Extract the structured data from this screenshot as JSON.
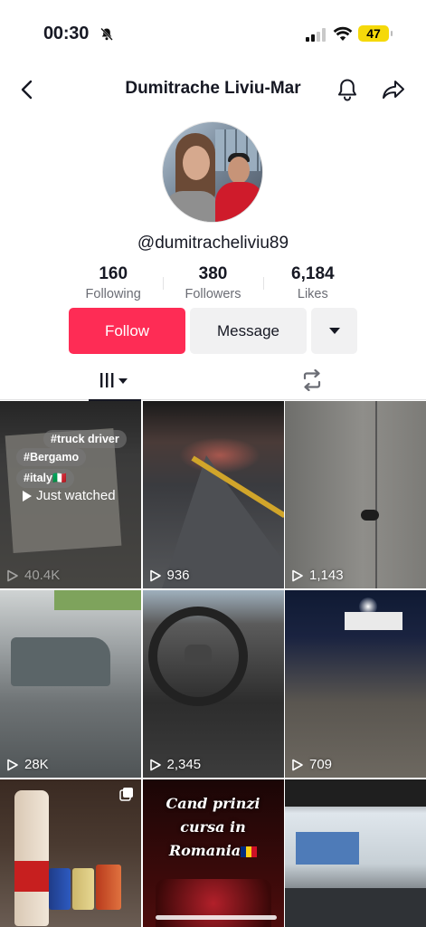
{
  "status_bar": {
    "time": "00:30",
    "battery": "47"
  },
  "header": {
    "title": "Dumitrache Liviu-Mar"
  },
  "profile": {
    "username": "@dumitracheliviu89",
    "stats": [
      {
        "value": "160",
        "label": "Following"
      },
      {
        "value": "380",
        "label": "Followers"
      },
      {
        "value": "6,184",
        "label": "Likes"
      }
    ]
  },
  "actions": {
    "follow_label": "Follow",
    "message_label": "Message"
  },
  "colors": {
    "follow": "#fe2c55",
    "battery": "#f5d90a"
  },
  "grid": {
    "videos": [
      {
        "views": "40.4K",
        "tags": [
          "truck driver",
          "Bergamo",
          "italy🇮🇹"
        ],
        "overlay": "Just watched"
      },
      {
        "views": "936"
      },
      {
        "views": "1,143"
      },
      {
        "views": "28K"
      },
      {
        "views": "2,345"
      },
      {
        "views": "709"
      },
      {
        "views": ""
      },
      {
        "views": "",
        "caption_lines": [
          "Cand prinzi",
          "cursa in",
          "Romania"
        ]
      },
      {
        "views": ""
      }
    ]
  }
}
